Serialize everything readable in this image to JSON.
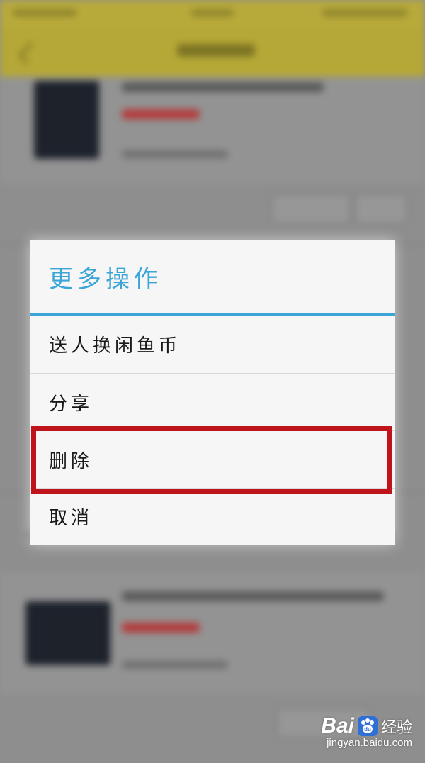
{
  "dialog": {
    "title": "更多操作",
    "options": [
      {
        "label": "送人换闲鱼币"
      },
      {
        "label": "分享"
      },
      {
        "label": "删除"
      },
      {
        "label": "取消"
      }
    ]
  },
  "colors": {
    "accent": "#3aa5d6",
    "highlight": "#c0141b",
    "header": "#b6a836"
  },
  "watermark": {
    "brand": "Bai",
    "brand_cn": "经验",
    "url": "jingyan.baidu.com"
  }
}
